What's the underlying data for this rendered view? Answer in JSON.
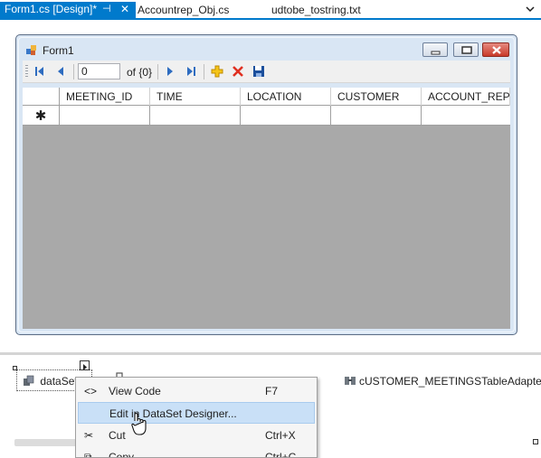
{
  "tabs": [
    {
      "label": "Form1.cs [Design]*",
      "active": true
    },
    {
      "label": "Accountrep_Obj.cs",
      "active": false
    },
    {
      "label": "udtobe_tostring.txt",
      "active": false
    }
  ],
  "tab_icons": {
    "pin": "pin-icon",
    "close": "close-icon",
    "overflow": "chevron-down-icon"
  },
  "colors": {
    "accent": "#007acc",
    "grid_background": "#a9a9a9",
    "menu_highlight": "#c9e0f7"
  },
  "form": {
    "title": "Form1"
  },
  "navigator": {
    "position_value": "0",
    "count_text": "of {0}",
    "buttons": [
      "move-first-icon",
      "move-previous-icon",
      "move-next-icon",
      "move-last-icon",
      "add-new-icon",
      "delete-icon",
      "save-icon"
    ]
  },
  "grid": {
    "columns": [
      "MEETING_ID",
      "TIME",
      "LOCATION",
      "CUSTOMER",
      "ACCOUNT_REP"
    ],
    "new_row_marker": "✱"
  },
  "tray": {
    "dataset_label": "dataSet",
    "adapter_label": "cUSTOMER_MEETINGSTableAdapter"
  },
  "context_menu": {
    "items": [
      {
        "icon": "code-icon",
        "icon_glyph": "<>",
        "label": "View Code",
        "shortcut": "F7",
        "highlighted": false
      },
      {
        "icon": "",
        "icon_glyph": "",
        "label": "Edit in DataSet Designer...",
        "shortcut": "",
        "highlighted": true
      },
      {
        "icon": "scissors-icon",
        "icon_glyph": "✂",
        "label": "Cut",
        "shortcut": "Ctrl+X",
        "highlighted": false
      },
      {
        "icon": "copy-icon",
        "icon_glyph": "⧉",
        "label": "Copy",
        "shortcut": "Ctrl+C",
        "highlighted": false
      }
    ]
  }
}
